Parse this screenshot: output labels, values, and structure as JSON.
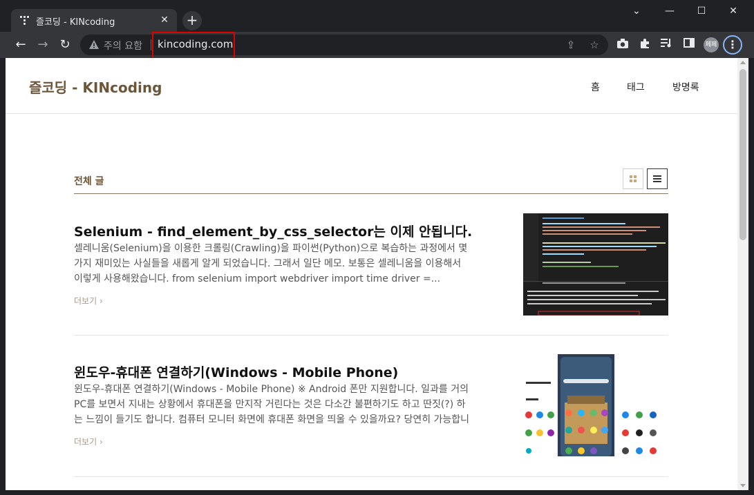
{
  "browser": {
    "tab_title": "즐코딩 - KINcoding",
    "security_text": "주의 요함",
    "url": "kincoding.com",
    "avatar_text": "페페",
    "icons": [
      "back-arrow-icon",
      "forward-arrow-icon",
      "reload-icon",
      "warning-icon",
      "share-icon",
      "star-icon",
      "camera-icon",
      "extensions-icon",
      "media-icon",
      "sidepanel-icon",
      "menu-icon"
    ]
  },
  "site": {
    "title": "즐코딩 - KINcoding",
    "nav": [
      "홈",
      "태그",
      "방명록"
    ]
  },
  "list": {
    "title": "전체 글"
  },
  "posts": [
    {
      "title": "Selenium - find_element_by_css_selector는 이제 안됩니다.",
      "excerpt": "셀레니움(Selenium)을 이용한 크롤링(Crawling)을 파이썬(Python)으로 복습하는 과정에서 몇 가지 재미있는 사실들을 새롭게 알게 되었습니다. 그래서 일단 메모. 보통은 셀레니움을 이용해서 이렇게 사용해왔습니다. from selenium import webdriver import time driver =...",
      "more": "더보기"
    },
    {
      "title": "윈도우-휴대폰 연결하기(Windows - Mobile Phone)",
      "excerpt": "윈도우-휴대폰 연결하기(Windows - Mobile Phone) ※ Android 폰만 지원합니다. 일과를 거의 PC를 보면서 지내는 상황에서 휴대폰을 만지작 거린다는 것은 다소간 불편하기도 하고 딴짓(?) 하는 느낌이 들기도 합니다. 컴퓨터 모니터 화면에 휴대폰 화면을 띄울 수 있을까요? 당연히 가능합니다...",
      "more": "더보기"
    }
  ]
}
